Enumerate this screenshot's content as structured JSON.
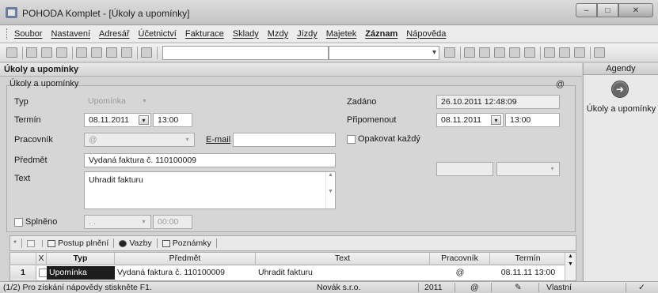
{
  "window": {
    "title": "POHODA Komplet - [Úkoly a upomínky]",
    "buttons": [
      "–",
      "□",
      "✕"
    ]
  },
  "menu": {
    "items": [
      "Soubor",
      "Nastavení",
      "Adresář",
      "Účetnictví",
      "Fakturace",
      "Sklady",
      "Mzdy",
      "Jízdy",
      "Majetek",
      "Záznam",
      "Nápověda"
    ],
    "bold_item": "Záznam"
  },
  "section": {
    "header": "Úkoly a upomínky",
    "panel_title": "Úkoly a upomínky",
    "marker": "@"
  },
  "form": {
    "typ_label": "Typ",
    "typ_value": "Upomínka",
    "termin_label": "Termín",
    "termin_date": "08.11.2011",
    "termin_time": "13:00",
    "pracovnik_label": "Pracovník",
    "pracovnik_value": "@",
    "email_link": "E-mail",
    "email_value": "",
    "predmet_label": "Předmět",
    "predmet_value": "Vydaná faktura č. 110100009",
    "text_label": "Text",
    "text_value": "Uhradit fakturu",
    "splneno_label": "Splněno",
    "splneno_date": ". .",
    "splneno_time": "00:00",
    "zadano_label": "Zadáno",
    "zadano_value": "26.10.2011 12:48:09",
    "pripomenout_label": "Připomenout",
    "pripomenout_date": "08.11.2011",
    "pripomenout_time": "13:00",
    "opakovat_label": "Opakovat každý"
  },
  "tabs": {
    "star": "*",
    "items": [
      "Postup plnění",
      "Vazby",
      "Poznámky"
    ]
  },
  "grid": {
    "headers": [
      "X",
      "Typ",
      "Předmět",
      "Text",
      "Pracovník",
      "Termín"
    ],
    "row": {
      "num": "1",
      "typ": "Upomínka",
      "predmet": "Vydaná faktura č. 110100009",
      "text": "Uhradit fakturu",
      "pracovnik": "@",
      "termin": "08.11.11 13:00"
    }
  },
  "agendy": {
    "title": "Agendy",
    "item": "Úkoly a upomínky"
  },
  "status": {
    "help": "(1/2) Pro získání nápovědy stiskněte F1.",
    "company": "Novák s.r.o.",
    "year": "2011",
    "marker": "@",
    "mode": "Vlastní"
  }
}
